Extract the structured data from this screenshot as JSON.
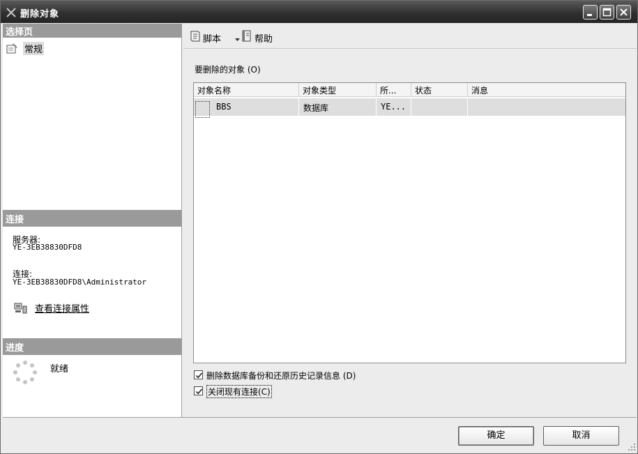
{
  "window": {
    "title": "删除对象"
  },
  "left_pane": {
    "select_page_header": "选择页",
    "nav_items": [
      {
        "label": "常规",
        "icon": "properties-page-icon"
      }
    ],
    "connection_header": "连接",
    "server_label": "服务器:",
    "server_value": "YE-3EB38830DFD8",
    "connection_label": "连接:",
    "connection_value": "YE-3EB38830DFD8\\Administrator",
    "view_connection_link": "查看连接属性",
    "progress_header": "进度",
    "progress_status": "就绪"
  },
  "toolbar": {
    "script_label": "脚本",
    "help_label": "帮助"
  },
  "main": {
    "objects_label": "要删除的对象 (O)",
    "grid": {
      "columns": [
        "对象名称",
        "对象类型",
        "所...",
        "状态",
        "消息"
      ],
      "rows": [
        {
          "name": "BBS",
          "type": "数据库",
          "owner": "YE...",
          "status": "",
          "message": ""
        }
      ]
    },
    "option_delete_backup": {
      "label": "删除数据库备份和还原历史记录信息 (D)",
      "checked": true
    },
    "option_close_connections": {
      "label": "关闭现有连接(C)",
      "checked": true
    }
  },
  "buttons": {
    "ok_label": "确定",
    "cancel_label": "取消"
  }
}
